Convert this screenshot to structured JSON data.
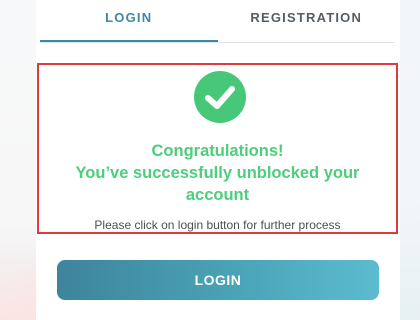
{
  "tabs": [
    {
      "label": "LOGIN",
      "active": true
    },
    {
      "label": "REGISTRATION",
      "active": false
    }
  ],
  "success": {
    "icon": "check-circle-icon",
    "title_line1": "Congratulations!",
    "title_line2": "You’ve successfully unblocked your",
    "title_line3": "account",
    "note": "Please click on login button for further process"
  },
  "login_button": {
    "label": "LOGIN"
  },
  "colors": {
    "accent": "#3a8aa3",
    "success": "#4cce7b",
    "highlight_border": "#e03a3a"
  }
}
